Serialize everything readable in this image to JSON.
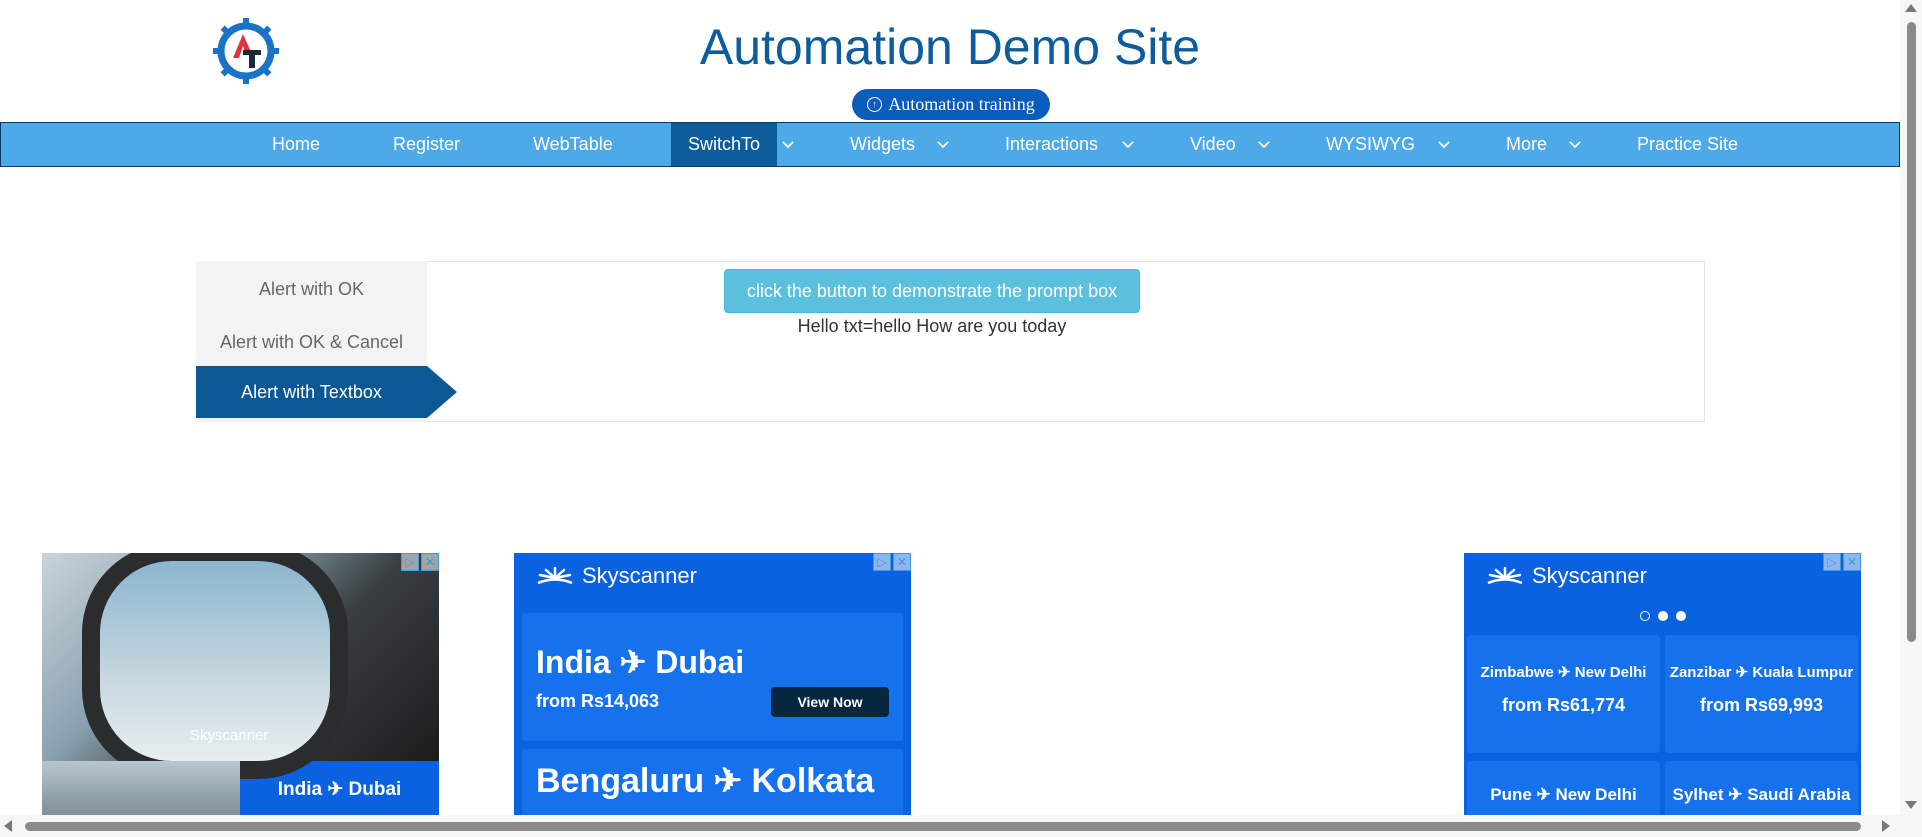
{
  "header": {
    "title": "Automation Demo Site",
    "training_button": "Automation training",
    "logo_icon": "gear-logo-icon",
    "brand_color": "#0d5d9d"
  },
  "nav": {
    "items": [
      {
        "label": "Home"
      },
      {
        "label": "Register"
      },
      {
        "label": "WebTable"
      },
      {
        "label": "SwitchTo",
        "active": true
      },
      {
        "label": "Widgets"
      },
      {
        "label": "Interactions"
      },
      {
        "label": "Video"
      },
      {
        "label": "WYSIWYG"
      },
      {
        "label": "More"
      },
      {
        "label": "Practice Site"
      }
    ],
    "color": "#4ea9e8"
  },
  "alerts": {
    "tabs": [
      {
        "label": "Alert with OK"
      },
      {
        "label": "Alert with OK & Cancel"
      },
      {
        "label": "Alert with Textbox",
        "active": true
      }
    ],
    "prompt_button": "click the button to demonstrate the prompt box",
    "result_text": "Hello txt=hello How are you today"
  },
  "ads": {
    "brand": "Skyscanner",
    "ad1": {
      "route": "India ✈ Dubai"
    },
    "ad2": {
      "route1": "India ✈ Dubai",
      "price1": "from Rs14,063",
      "cta": "View Now",
      "route2": "Bengaluru ✈ Kolkata"
    },
    "ad3": {
      "cells": [
        {
          "route": "Zimbabwe ✈ New Delhi",
          "price": "from Rs61,774"
        },
        {
          "route": "Zanzibar ✈ Kuala Lumpur",
          "price": "from Rs69,993"
        }
      ],
      "bottom": [
        {
          "route": "Pune ✈ New Delhi"
        },
        {
          "route": "Sylhet ✈ Saudi Arabia"
        }
      ]
    }
  }
}
